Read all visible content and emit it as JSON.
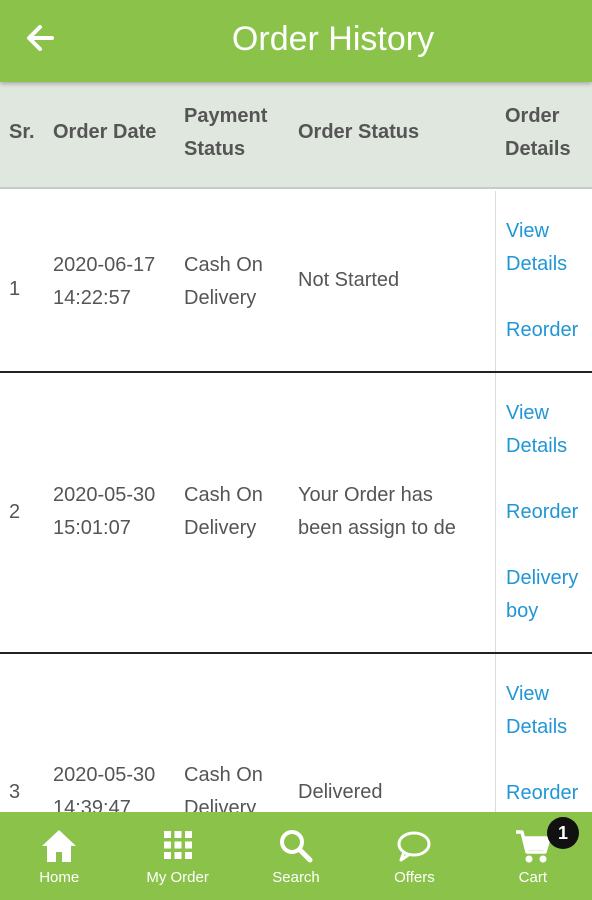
{
  "header": {
    "title": "Order History",
    "back_icon": "arrow-left-icon"
  },
  "table": {
    "columns": {
      "sr": "Sr.",
      "order_date": "Order Date",
      "payment_status_1": "Payment",
      "payment_status_2": "Status",
      "order_status": "Order Status",
      "order_details_1": "Order",
      "order_details_2": "Details"
    },
    "rows": [
      {
        "sr": "1",
        "date": "2020-06-17",
        "time": "14:22:57",
        "payment_1": "Cash On",
        "payment_2": "Delivery",
        "status_1": "Not Started",
        "status_2": "",
        "view_1": "View",
        "view_2": "Details",
        "reorder": "Reorder"
      },
      {
        "sr": "2",
        "date": "2020-05-30",
        "time": "15:01:07",
        "payment_1": "Cash On",
        "payment_2": "Delivery",
        "status_1": "Your Order has",
        "status_2": "been assign to de",
        "view_1": "View",
        "view_2": "Details",
        "reorder": "Reorder",
        "delivery_1": "Delivery",
        "delivery_2": "boy"
      },
      {
        "sr": "3",
        "date": "2020-05-30",
        "time": "14:39:47",
        "payment_1": "Cash On",
        "payment_2": "Delivery",
        "status_1": "Delivered",
        "status_2": "",
        "view_1": "View",
        "view_2": "Details",
        "reorder": "Reorder"
      }
    ]
  },
  "bottom_nav": {
    "items": [
      {
        "label": "Home",
        "icon": "home-icon"
      },
      {
        "label": "My Order",
        "icon": "grid-icon"
      },
      {
        "label": "Search",
        "icon": "search-icon"
      },
      {
        "label": "Offers",
        "icon": "chat-bubble-icon"
      },
      {
        "label": "Cart",
        "icon": "cart-icon"
      }
    ],
    "cart_count": "1"
  },
  "colors": {
    "primary": "#8bc34a",
    "header_row_bg": "#dfe7df",
    "link": "#2196d6",
    "text": "#555555",
    "badge": "#111111"
  }
}
